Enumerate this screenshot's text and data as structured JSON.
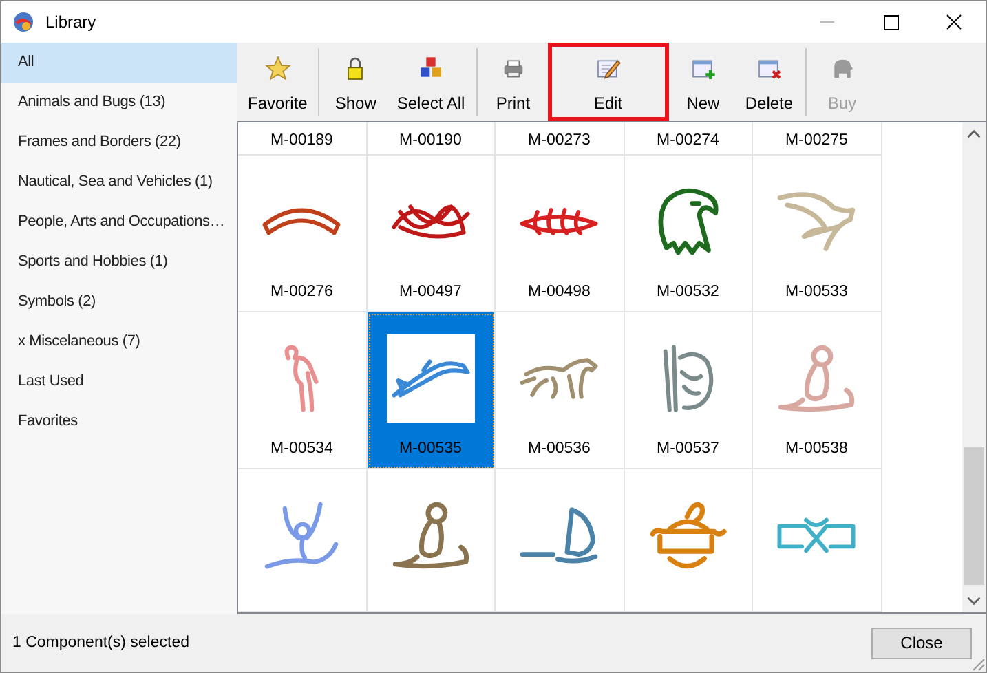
{
  "window": {
    "title": "Library"
  },
  "sidebar": {
    "items": [
      {
        "label": "All",
        "selected": true
      },
      {
        "label": "Animals and Bugs (13)",
        "selected": false
      },
      {
        "label": "Frames and Borders (22)",
        "selected": false
      },
      {
        "label": "Nautical, Sea and Vehicles (1)",
        "selected": false
      },
      {
        "label": "People, Arts and Occupations…",
        "selected": false
      },
      {
        "label": "Sports and Hobbies (1)",
        "selected": false
      },
      {
        "label": "Symbols (2)",
        "selected": false
      },
      {
        "label": "x Miscelaneous (7)",
        "selected": false
      },
      {
        "label": "Last Used",
        "selected": false
      },
      {
        "label": "Favorites",
        "selected": false
      }
    ]
  },
  "toolbar": {
    "groups": [
      [
        {
          "label": "Favorite",
          "kind": "star",
          "disabled": false,
          "highlighted": false
        }
      ],
      [
        {
          "label": "Show",
          "kind": "lock",
          "disabled": false,
          "highlighted": false
        },
        {
          "label": "Select All",
          "kind": "cubes",
          "disabled": false,
          "highlighted": false
        }
      ],
      [
        {
          "label": "Print",
          "kind": "printer",
          "disabled": false,
          "highlighted": false
        },
        {
          "label": "Edit",
          "kind": "edit",
          "disabled": false,
          "highlighted": true
        },
        {
          "label": "New",
          "kind": "new",
          "disabled": false,
          "highlighted": false
        },
        {
          "label": "Delete",
          "kind": "delete",
          "disabled": false,
          "highlighted": false
        }
      ],
      [
        {
          "label": "Buy",
          "kind": "animal",
          "disabled": true,
          "highlighted": false
        }
      ]
    ]
  },
  "items": [
    {
      "label": "M-00189",
      "selected": false
    },
    {
      "label": "M-00190",
      "selected": false
    },
    {
      "label": "M-00273",
      "selected": false
    },
    {
      "label": "M-00274",
      "selected": false
    },
    {
      "label": "M-00275",
      "selected": false
    },
    {
      "label": "M-00276",
      "kind": "arch",
      "color": "#c0401a",
      "selected": false
    },
    {
      "label": "M-00497",
      "kind": "knot",
      "color": "#c01818",
      "selected": false
    },
    {
      "label": "M-00498",
      "kind": "chain",
      "color": "#d82020",
      "selected": false
    },
    {
      "label": "M-00532",
      "kind": "eagle",
      "color": "#1e6a1e",
      "selected": false
    },
    {
      "label": "M-00533",
      "kind": "bird",
      "color": "#c8b89a",
      "selected": false
    },
    {
      "label": "M-00534",
      "kind": "flamingo",
      "color": "#e89090",
      "selected": false
    },
    {
      "label": "M-00535",
      "kind": "dolphin",
      "color": "#3a88d8",
      "selected": true
    },
    {
      "label": "M-00536",
      "kind": "horse",
      "color": "#a09070",
      "selected": false
    },
    {
      "label": "M-00537",
      "kind": "bear",
      "color": "#7a8a8a",
      "selected": false
    },
    {
      "label": "M-00538",
      "kind": "figure",
      "color": "#d8a8a0",
      "selected": false
    },
    {
      "kind": "dancer",
      "color": "#7a9ae8",
      "selected": false
    },
    {
      "kind": "figure",
      "color": "#8a7450",
      "selected": false
    },
    {
      "kind": "sailboat",
      "color": "#4a82a8",
      "selected": false
    },
    {
      "kind": "scroll",
      "color": "#d88010",
      "selected": false
    },
    {
      "kind": "ribbon",
      "color": "#40b0c8",
      "selected": false
    }
  ],
  "status_bar": {
    "text": "1 Component(s) selected",
    "button": "Close"
  }
}
